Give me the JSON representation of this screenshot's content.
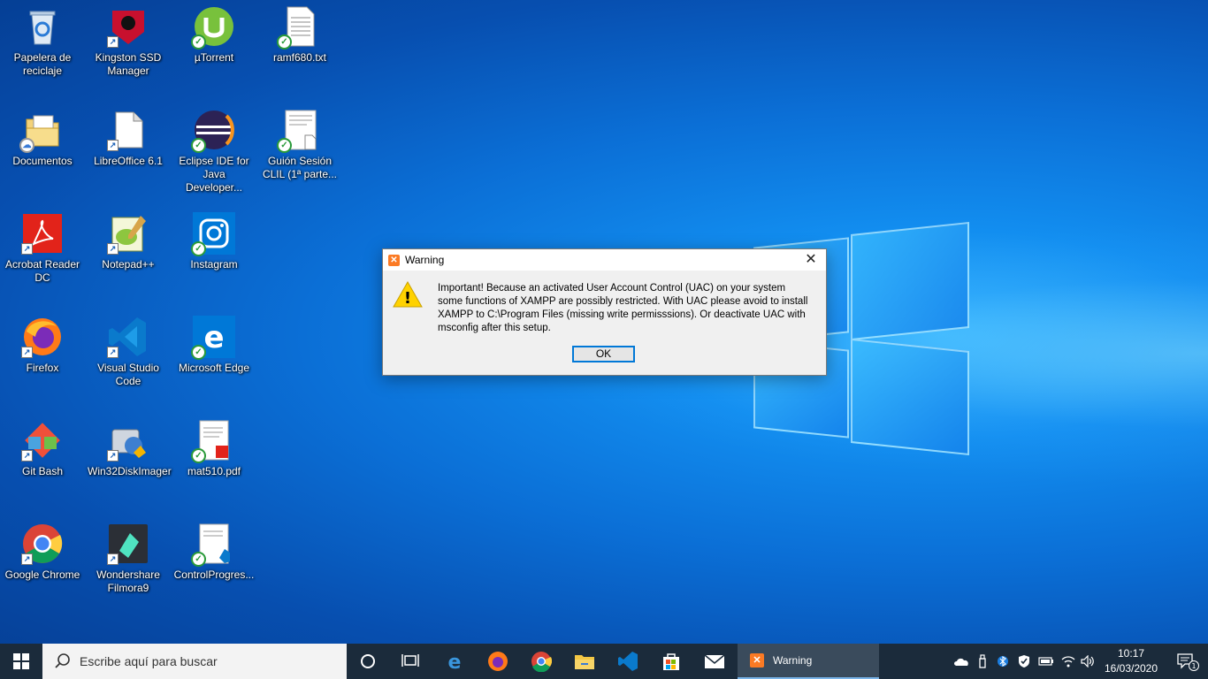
{
  "desktop": {
    "icons": [
      {
        "label": "Papelera de reciclaje",
        "icon": "recycle-bin-icon"
      },
      {
        "label": "Kingston SSD Manager",
        "icon": "kingston-icon"
      },
      {
        "label": "µTorrent",
        "icon": "utorrent-icon"
      },
      {
        "label": "ramf680.txt",
        "icon": "text-file-icon"
      },
      {
        "label": "Documentos",
        "icon": "documents-folder-icon"
      },
      {
        "label": "LibreOffice 6.1",
        "icon": "libreoffice-icon"
      },
      {
        "label": "Eclipse IDE for Java Developer...",
        "icon": "eclipse-icon"
      },
      {
        "label": "Guión Sesión CLIL (1ª parte...",
        "icon": "document-file-icon"
      },
      {
        "label": "Acrobat Reader DC",
        "icon": "acrobat-icon"
      },
      {
        "label": "Notepad++",
        "icon": "notepadpp-icon"
      },
      {
        "label": "Instagram",
        "icon": "instagram-icon"
      },
      {
        "label": "Firefox",
        "icon": "firefox-icon"
      },
      {
        "label": "Visual Studio Code",
        "icon": "vscode-icon"
      },
      {
        "label": "Microsoft Edge",
        "icon": "edge-icon"
      },
      {
        "label": "Git Bash",
        "icon": "git-icon"
      },
      {
        "label": "Win32DiskImager",
        "icon": "diskimager-icon"
      },
      {
        "label": "mat510.pdf",
        "icon": "pdf-file-icon"
      },
      {
        "label": "Google Chrome",
        "icon": "chrome-icon"
      },
      {
        "label": "Wondershare Filmora9",
        "icon": "filmora-icon"
      },
      {
        "label": "ControlProgres...",
        "icon": "vscode-file-icon"
      }
    ]
  },
  "dialog": {
    "title": "Warning",
    "message": "Important! Because an activated User Account Control (UAC) on your system some functions of XAMPP are possibly restricted. With UAC please avoid to install XAMPP to C:\\Program Files (missing write permisssions). Or deactivate UAC with msconfig after this setup.",
    "ok_label": "OK",
    "close_glyph": "✕",
    "warning_glyph": "!"
  },
  "taskbar": {
    "search_placeholder": "Escribe aquí para buscar",
    "active_window": "Warning",
    "time": "10:17",
    "date": "16/03/2020",
    "notification_count": "1",
    "pinned": [
      "cortana-icon",
      "task-view-icon",
      "edge-icon",
      "firefox-icon",
      "chrome-icon",
      "file-explorer-icon",
      "vscode-icon",
      "store-icon",
      "mail-icon"
    ],
    "tray": [
      "onedrive-icon",
      "usb-icon",
      "bluetooth-icon",
      "security-icon",
      "battery-icon",
      "wifi-icon",
      "volume-icon"
    ]
  },
  "colors": {
    "accent": "#0078d7",
    "taskbar": "#1b2b3b",
    "xampp": "#fb7a24"
  }
}
